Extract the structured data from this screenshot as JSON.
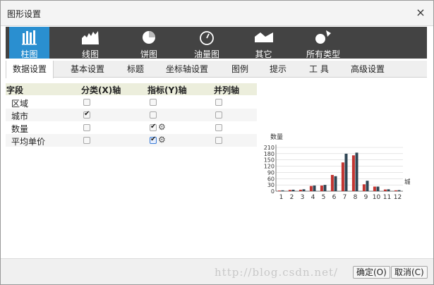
{
  "dialog": {
    "title": "图形设置",
    "close_symbol": "×"
  },
  "chart_types": [
    {
      "label": "柱图",
      "icon": "bar-chart-icon"
    },
    {
      "label": "线图",
      "icon": "line-chart-icon"
    },
    {
      "label": "饼图",
      "icon": "pie-chart-icon"
    },
    {
      "label": "油量图",
      "icon": "gauge-icon"
    },
    {
      "label": "其它",
      "icon": "other-chart-icon"
    },
    {
      "label": "所有类型",
      "icon": "all-types-icon"
    }
  ],
  "active_chart_type": "柱图",
  "tabs": [
    {
      "label": "数据设置"
    },
    {
      "label": "基本设置"
    },
    {
      "label": "标题"
    },
    {
      "label": "坐标轴设置"
    },
    {
      "label": "图例"
    },
    {
      "label": "提示"
    },
    {
      "label": "工 具"
    },
    {
      "label": "高级设置"
    }
  ],
  "active_tab": "数据设置",
  "fields_table": {
    "headers": {
      "field": "字段",
      "category_axis": "分类(X)轴",
      "metric_axis": "指标(Y)轴",
      "parallel_axis": "并列轴"
    },
    "rows": [
      {
        "name": "区域",
        "category": false,
        "metric": false,
        "parallel": false
      },
      {
        "name": "城市",
        "category": true,
        "metric": false,
        "parallel": false
      },
      {
        "name": "数量",
        "category": false,
        "metric": true,
        "parallel": false
      },
      {
        "name": "平均单价",
        "category": false,
        "metric": true,
        "parallel": false
      }
    ]
  },
  "chart_data": {
    "type": "bar",
    "ylabel": "数量",
    "xlabel": "城",
    "ylim": [
      0,
      210
    ],
    "yticks": [
      0,
      30,
      60,
      90,
      120,
      150,
      180,
      210
    ],
    "categories": [
      "1",
      "2",
      "3",
      "4",
      "5",
      "6",
      "7",
      "8",
      "9",
      "10",
      "11",
      "12"
    ],
    "series": [
      {
        "values": [
          3,
          6,
          7,
          25,
          27,
          78,
          138,
          172,
          33,
          22,
          8,
          4
        ],
        "color": "#c23531"
      },
      {
        "values": [
          4,
          7,
          9,
          27,
          30,
          72,
          180,
          185,
          50,
          22,
          9,
          5
        ],
        "color": "#2f4554"
      }
    ],
    "grid": true
  },
  "footer": {
    "watermark": "http://blog.csdn.net/",
    "ok_label": "确定(O)",
    "cancel_label": "取消(C)"
  }
}
